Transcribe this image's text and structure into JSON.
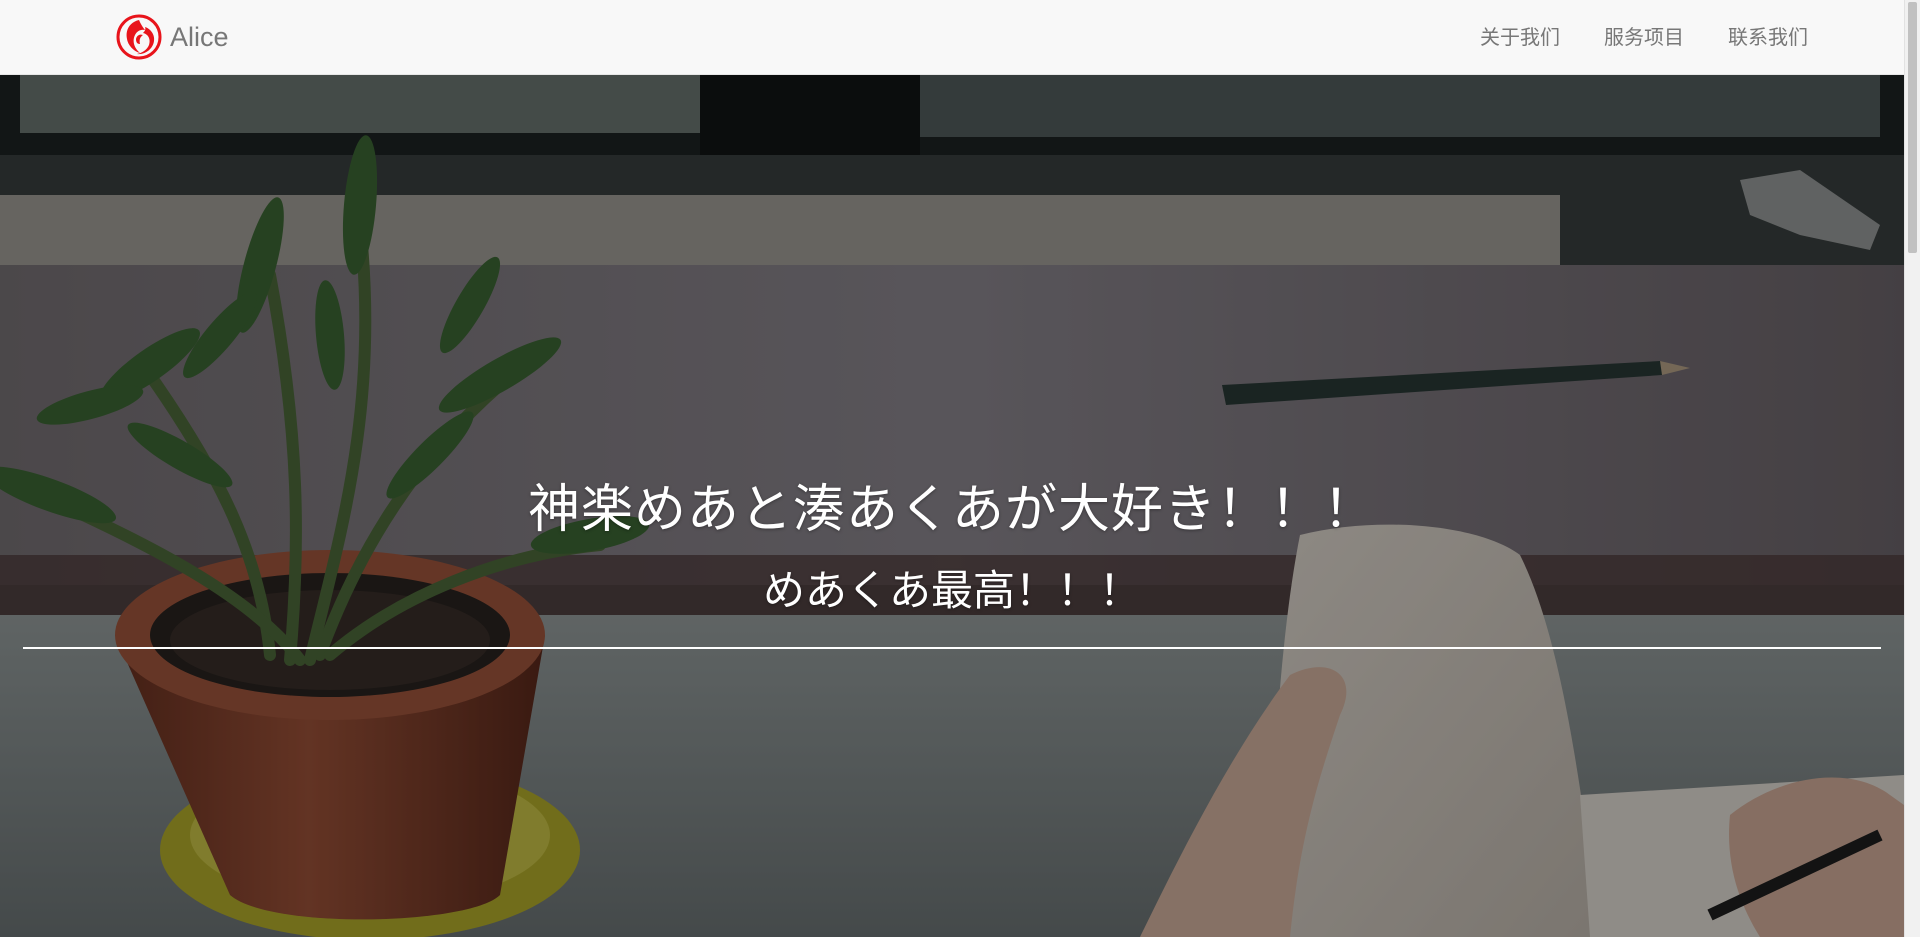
{
  "brand": {
    "name": "Alice",
    "logo_icon": "phoenix-logo-icon",
    "logo_color": "#e8141b"
  },
  "nav": {
    "items": [
      {
        "label": "关于我们"
      },
      {
        "label": "服务项目"
      },
      {
        "label": "联系我们"
      }
    ]
  },
  "hero": {
    "title": "神楽めあと湊あくあが大好き！！！",
    "subtitle": "めあくあ最高！！！"
  },
  "colors": {
    "navbar_bg": "#f8f8f8",
    "nav_text": "#777777",
    "hero_text": "#ffffff"
  }
}
